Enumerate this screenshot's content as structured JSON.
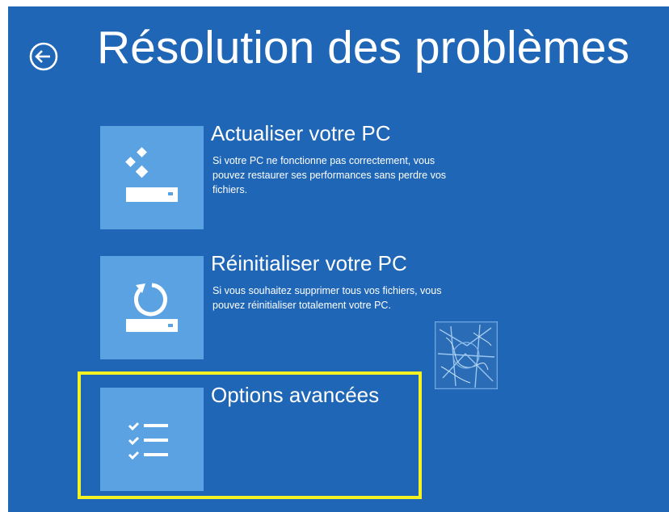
{
  "header": {
    "title": "Résolution des problèmes",
    "back_icon": "back-arrow-circle-icon"
  },
  "options": [
    {
      "title": "Actualiser votre PC",
      "description": "Si votre PC ne fonctionne pas correctement, vous pouvez restaurer ses performances sans perdre vos fichiers.",
      "icon": "refresh-pc-icon"
    },
    {
      "title": "Réinitialiser votre PC",
      "description": "Si vous souhaitez supprimer tous vos fichiers, vous pouvez réinitialiser totalement votre PC.",
      "icon": "reset-pc-icon"
    },
    {
      "title": "Options avancées",
      "description": "",
      "icon": "checklist-icon",
      "highlighted": true
    }
  ],
  "colors": {
    "background": "#1f66b6",
    "tile": "#5ba2e2",
    "text": "#ffffff",
    "highlight": "#f4f321"
  }
}
